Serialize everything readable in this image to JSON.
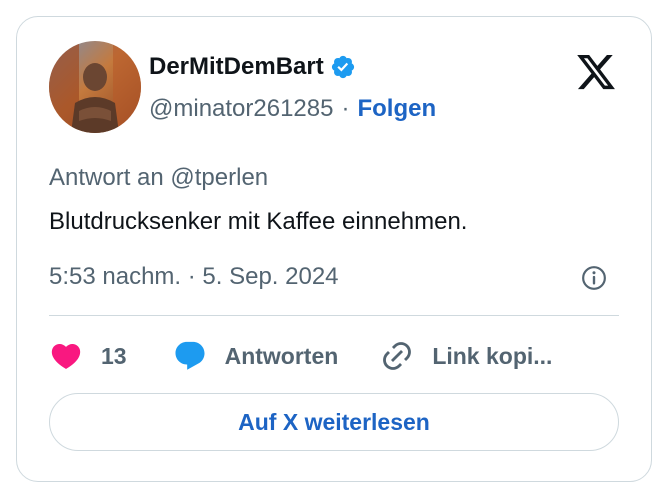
{
  "author": {
    "display_name": "DerMitDemBart",
    "handle": "@minator261285",
    "separator": "·",
    "follow_label": "Folgen",
    "verified_icon": "verified-badge-icon"
  },
  "tweet": {
    "reply_to": "Antwort an @tperlen",
    "text": "Blutdrucksenker mit Kaffee einnehmen.",
    "timestamp": "5:53 nachm. · 5. Sep. 2024"
  },
  "actions": {
    "like_count": "13",
    "reply_label": "Antworten",
    "copy_link_label": "Link kopi..."
  },
  "footer": {
    "read_more_label": "Auf X weiterlesen"
  },
  "colors": {
    "accent": "#1d9bf0",
    "link": "#1d64c4",
    "like": "#f91880",
    "muted": "#536471"
  }
}
